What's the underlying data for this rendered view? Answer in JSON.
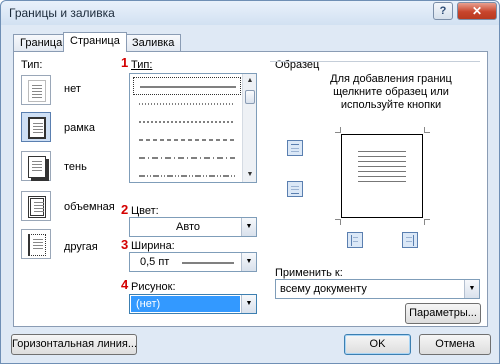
{
  "window": {
    "title": "Границы и заливка",
    "help_glyph": "?",
    "close_glyph": "✕"
  },
  "tabs": [
    {
      "label": "Граница",
      "active": false
    },
    {
      "label": "Страница",
      "active": true
    },
    {
      "label": "Заливка",
      "active": false
    }
  ],
  "type_section": {
    "label": "Тип:",
    "options": [
      {
        "label": "нет",
        "selected": false
      },
      {
        "label": "рамка",
        "selected": true
      },
      {
        "label": "тень",
        "selected": false
      },
      {
        "label": "объемная",
        "selected": false
      },
      {
        "label": "другая",
        "selected": false
      }
    ]
  },
  "style_section": {
    "marker": "1",
    "label": "Тип:",
    "line_styles": [
      "solid",
      "dotted",
      "dashed-small",
      "dashed",
      "dash-dot",
      "dash-dot-dot"
    ],
    "selected_index": 0
  },
  "color": {
    "marker": "2",
    "label": "Цвет:",
    "value": "Авто"
  },
  "width": {
    "marker": "3",
    "label": "Ширина:",
    "value": "0,5 пт"
  },
  "art": {
    "marker": "4",
    "label": "Рисунок:",
    "value": "(нет)"
  },
  "preview": {
    "label": "Образец",
    "hint_line1": "Для добавления границ",
    "hint_line2": "щелкните образец или",
    "hint_line3": "используйте кнопки"
  },
  "apply_to": {
    "label": "Применить к:",
    "value": "всему документу"
  },
  "buttons": {
    "options": "Параметры...",
    "horizontal_line": "Горизонтальная линия...",
    "ok": "OK",
    "cancel": "Отмена"
  },
  "colors": {
    "accent": "#3399ff",
    "marker_red": "#d40000"
  }
}
